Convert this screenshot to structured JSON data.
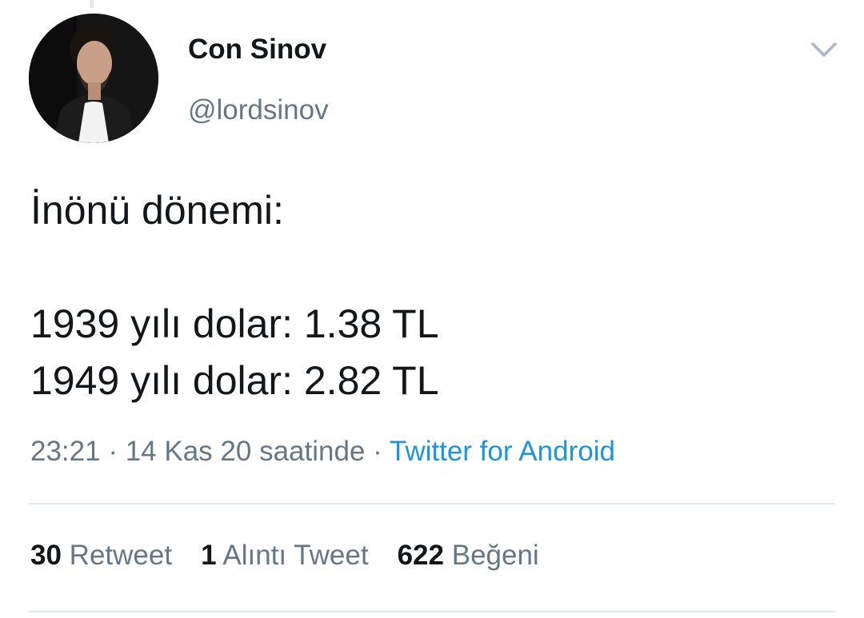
{
  "tweet": {
    "author": {
      "display_name": "Con Sinov",
      "handle": "@lordsinov"
    },
    "text_lines": [
      "İnönü dönemi:",
      "",
      "1939 yılı dolar: 1.38 TL",
      "1949 yılı dolar: 2.82 TL"
    ],
    "time": "23:21",
    "date": "14 Kas 20 saatinde",
    "separator": "·",
    "source": "Twitter for Android",
    "stats": {
      "retweets": {
        "count": "30",
        "label": "Retweet"
      },
      "quotes": {
        "count": "1",
        "label": "Alıntı Tweet"
      },
      "likes": {
        "count": "622",
        "label": "Beğeni"
      }
    }
  },
  "icons": {
    "menu": "chevron-down-icon",
    "avatar": "avatar"
  },
  "colors": {
    "primary_text": "#14171a",
    "secondary_text": "#657786",
    "link": "#1b95e0",
    "divider": "#e1e8ed"
  }
}
